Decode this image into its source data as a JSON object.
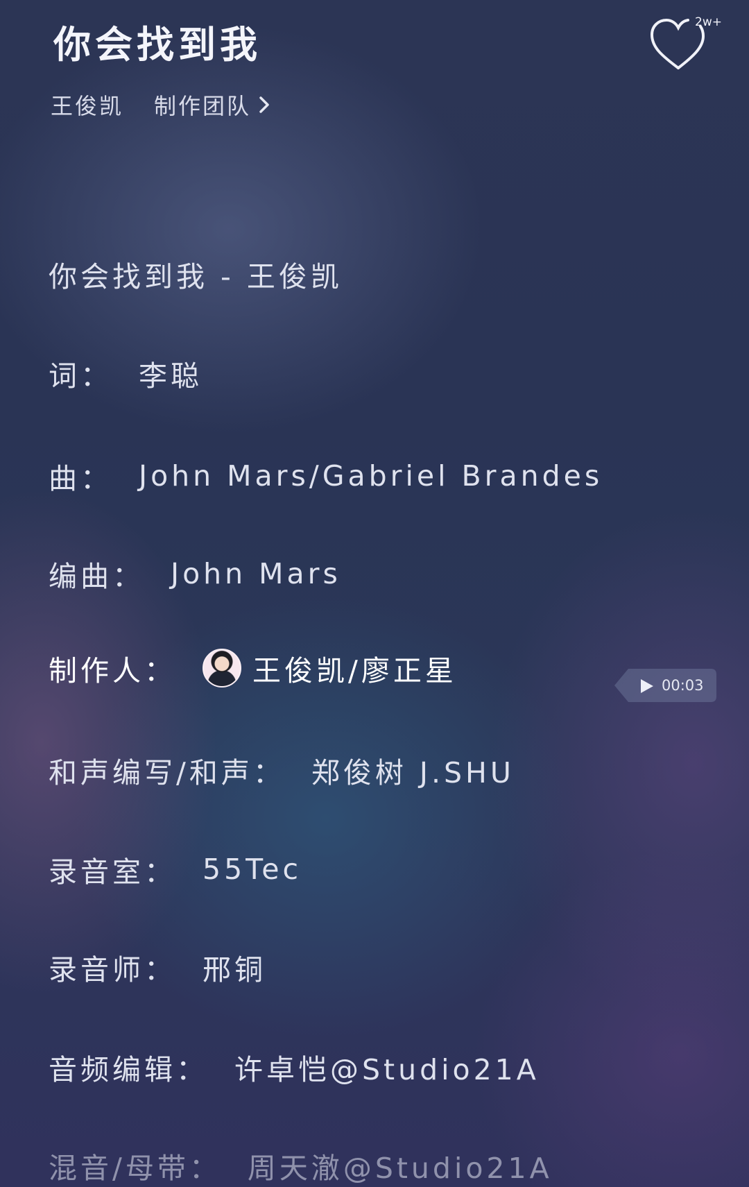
{
  "header": {
    "title": "你会找到我",
    "artist": "王俊凯",
    "team_link": "制作团队",
    "like_count": "2w+"
  },
  "credits": [
    {
      "label": "",
      "value": "你会找到我 - 王俊凯"
    },
    {
      "label": "词：",
      "value": "李聪"
    },
    {
      "label": "曲：",
      "value": "John Mars/Gabriel Brandes"
    },
    {
      "label": "编曲：",
      "value": "John Mars"
    },
    {
      "label": "制作人：",
      "value": "王俊凯/廖正星"
    },
    {
      "label": "和声编写/和声：",
      "value": "郑俊树 J.SHU"
    },
    {
      "label": "录音室：",
      "value": "55Tec"
    },
    {
      "label": "录音师：",
      "value": "邢铜"
    },
    {
      "label": "音频编辑：",
      "value": "许卓恺@Studio21A"
    },
    {
      "label": "混音/母带：",
      "value": "周天澈@Studio21A"
    }
  ],
  "playback": {
    "time": "00:03",
    "icon": "play-icon"
  },
  "colors": {
    "background_top": "#2c3555",
    "background_bottom": "#30325c",
    "text": "#dfe2ee",
    "chip": "#5a6388"
  }
}
